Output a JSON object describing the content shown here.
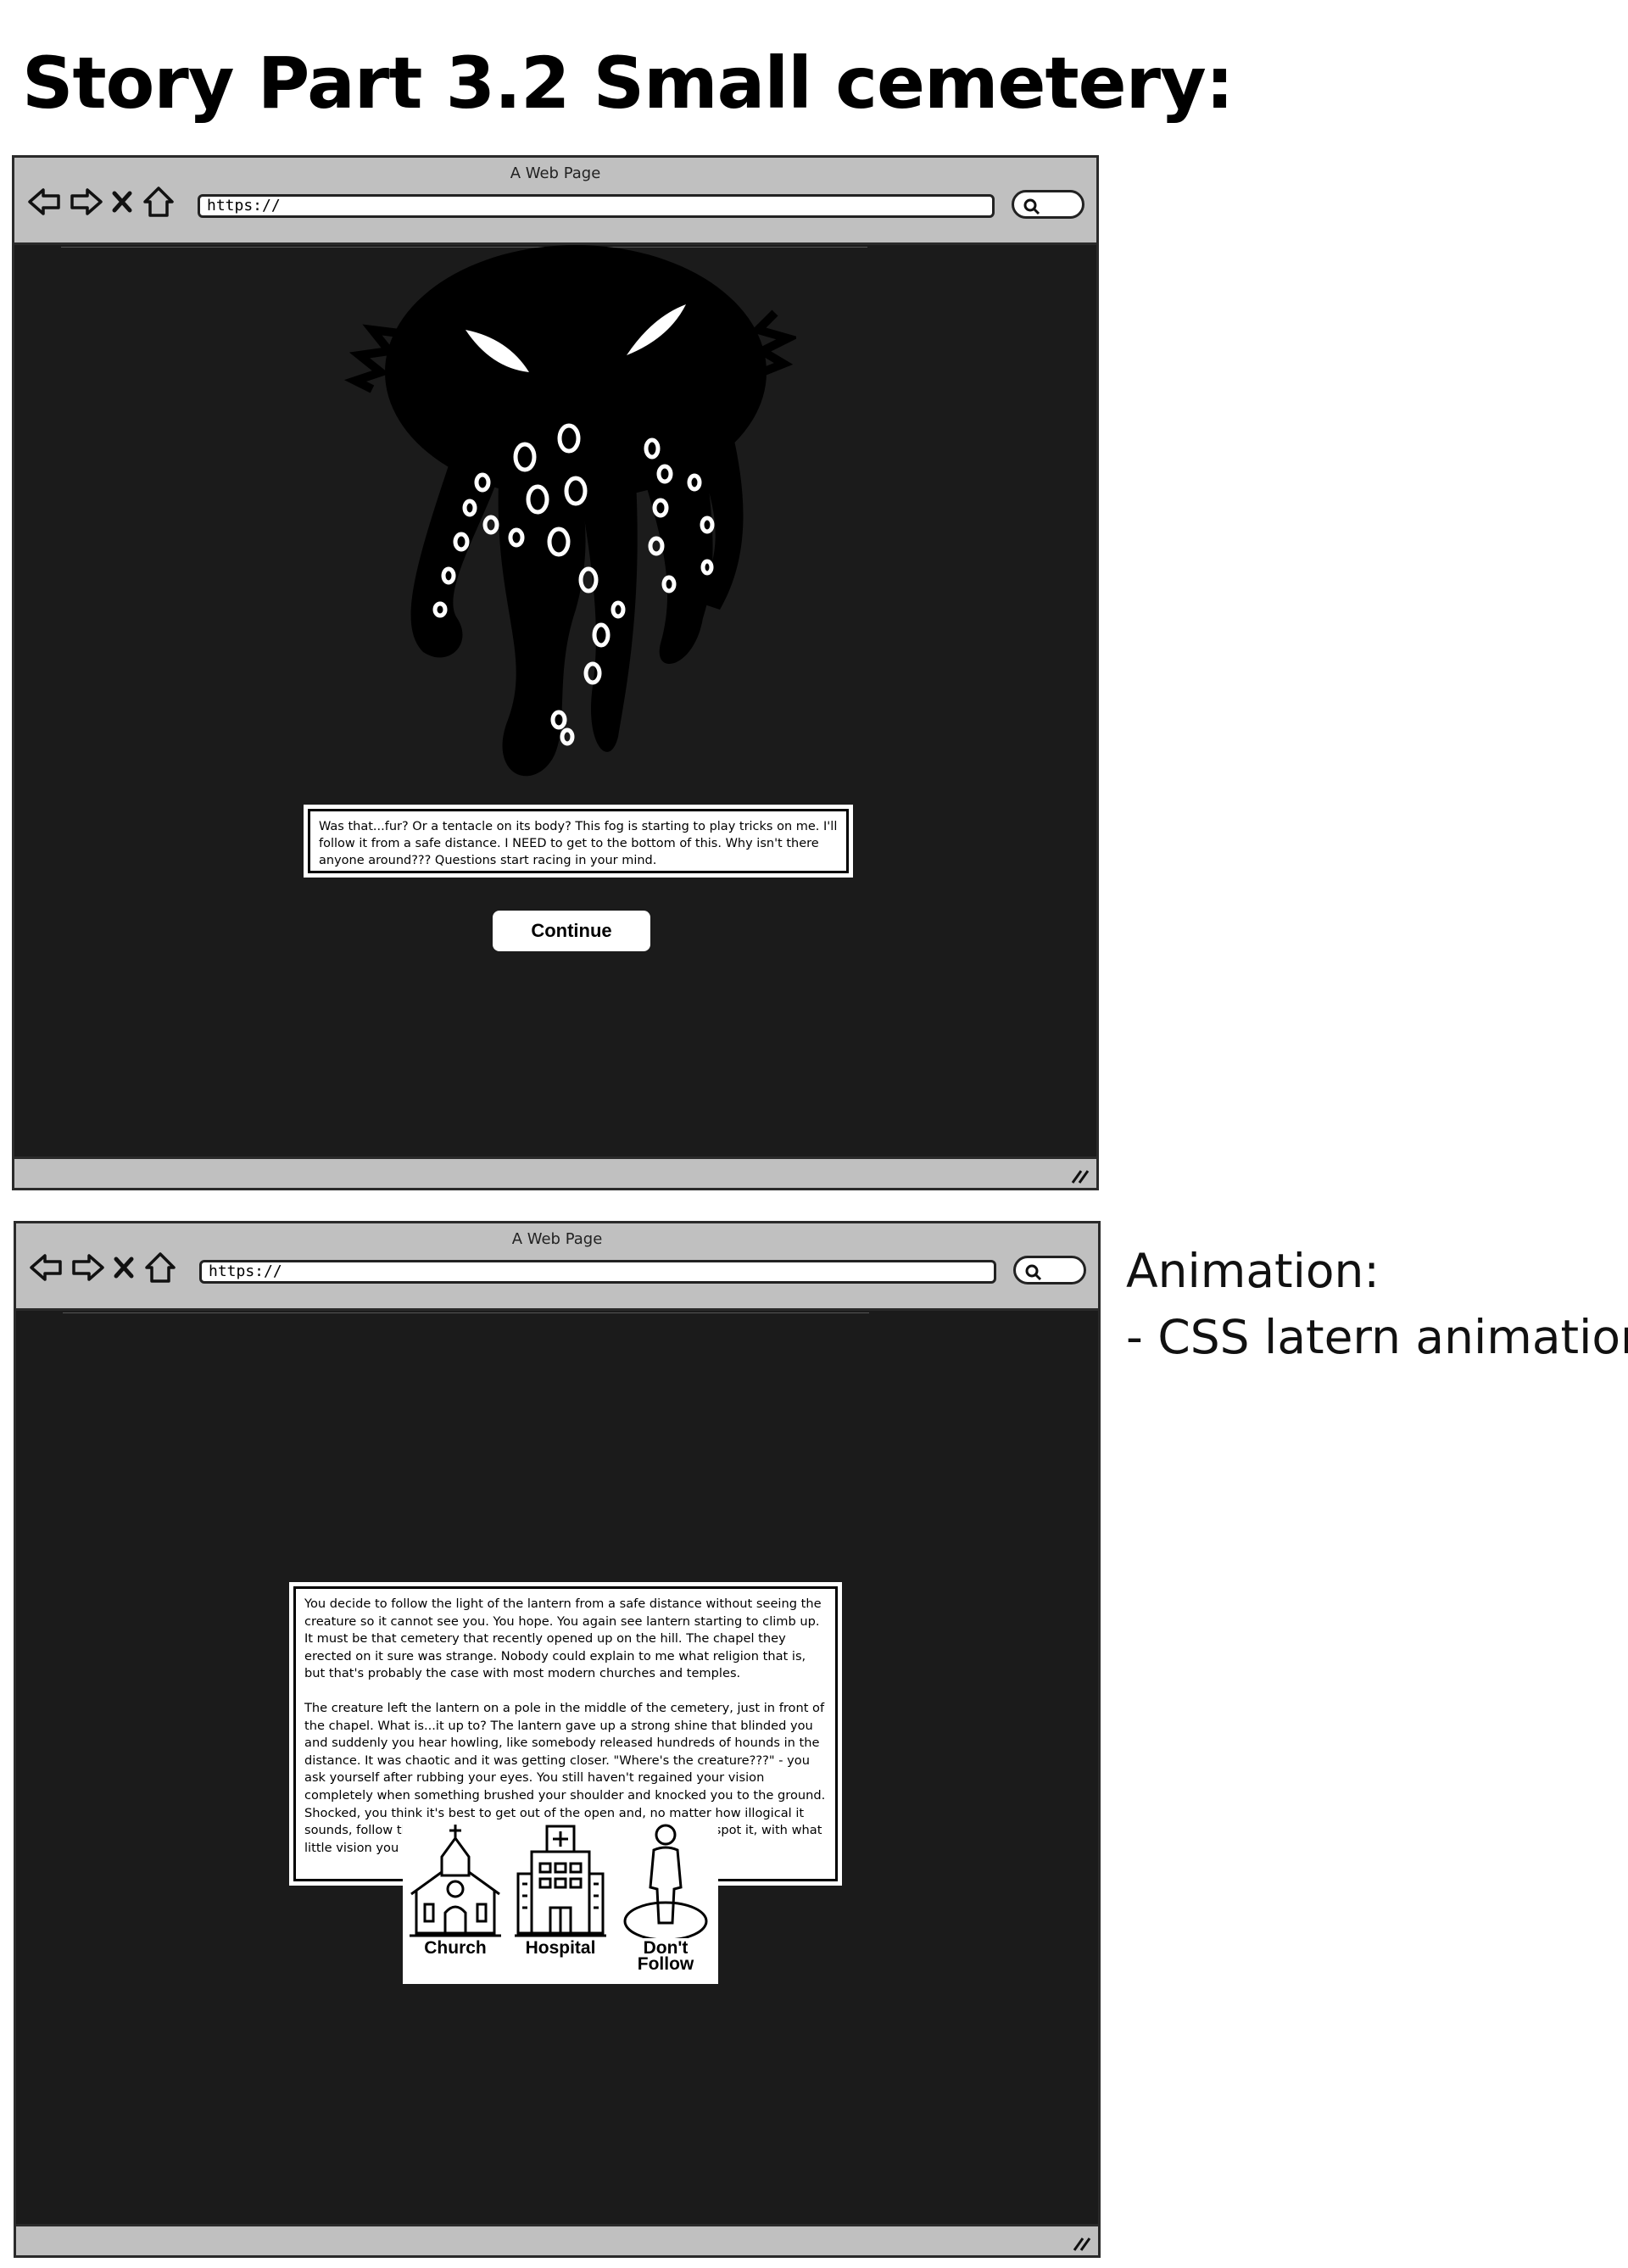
{
  "page_title": "Story Part 3.2 Small cemetery:",
  "browser": {
    "window_title": "A Web Page",
    "url": "https://"
  },
  "screen1": {
    "story_text": "Was that...fur? Or a tentacle on its body? This fog is starting to play tricks on me. I'll follow it from a safe distance. I NEED to get to the bottom of this. Why isn't there anyone around??? Questions start racing in your mind.",
    "continue_label": "Continue"
  },
  "screen2": {
    "paragraph1": "You decide to follow the light of the lantern from a safe distance without seeing the creature so it cannot see you. You hope. You again see lantern starting to climb up. It must be that cemetery that recently opened up on the hill. The chapel they erected on it sure was strange. Nobody could explain to me what religion that is, but that's probably the case with most modern churches and temples.",
    "paragraph2": "The creature left the lantern on a pole in the middle of the cemetery, just in front of the chapel. What is...it up to? The lantern gave up a strong shine that blinded you and suddenly you hear howling, like somebody released hundreds of hounds in the distance. It was chaotic and it was getting closer. \"Where's the creature???\" - you ask yourself after rubbing your eyes. You still haven't regained your vision completely when something brushed your shoulder and knocked you to the ground. Shocked, you think it's best to get out of the open and, no matter how illogical it sounds, follow the creature - just to get out of here! You suddenly spot it, with what little vision you have left, heading to the:",
    "choices": [
      {
        "label": "Church",
        "icon": "church-icon"
      },
      {
        "label": "Hospital",
        "icon": "hospital-icon"
      },
      {
        "label": "Don't\nFollow",
        "icon": "person-icon"
      }
    ]
  },
  "animation_note": {
    "title": "Animation:",
    "item": "- CSS latern animation"
  }
}
